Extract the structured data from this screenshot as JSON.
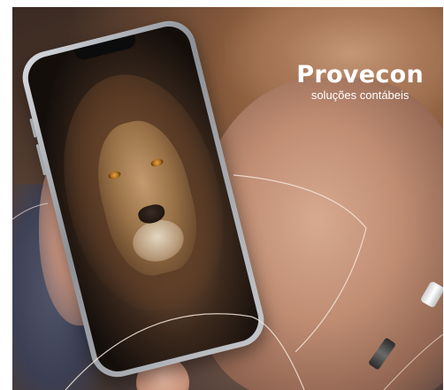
{
  "brand": {
    "name": "Provecon",
    "tagline": "soluções contábeis"
  },
  "image": {
    "subject": "hands holding a smartphone showing a lion photo"
  },
  "colors": {
    "brand_text": "#ffffff",
    "deco_line": "#f3e6dc"
  }
}
